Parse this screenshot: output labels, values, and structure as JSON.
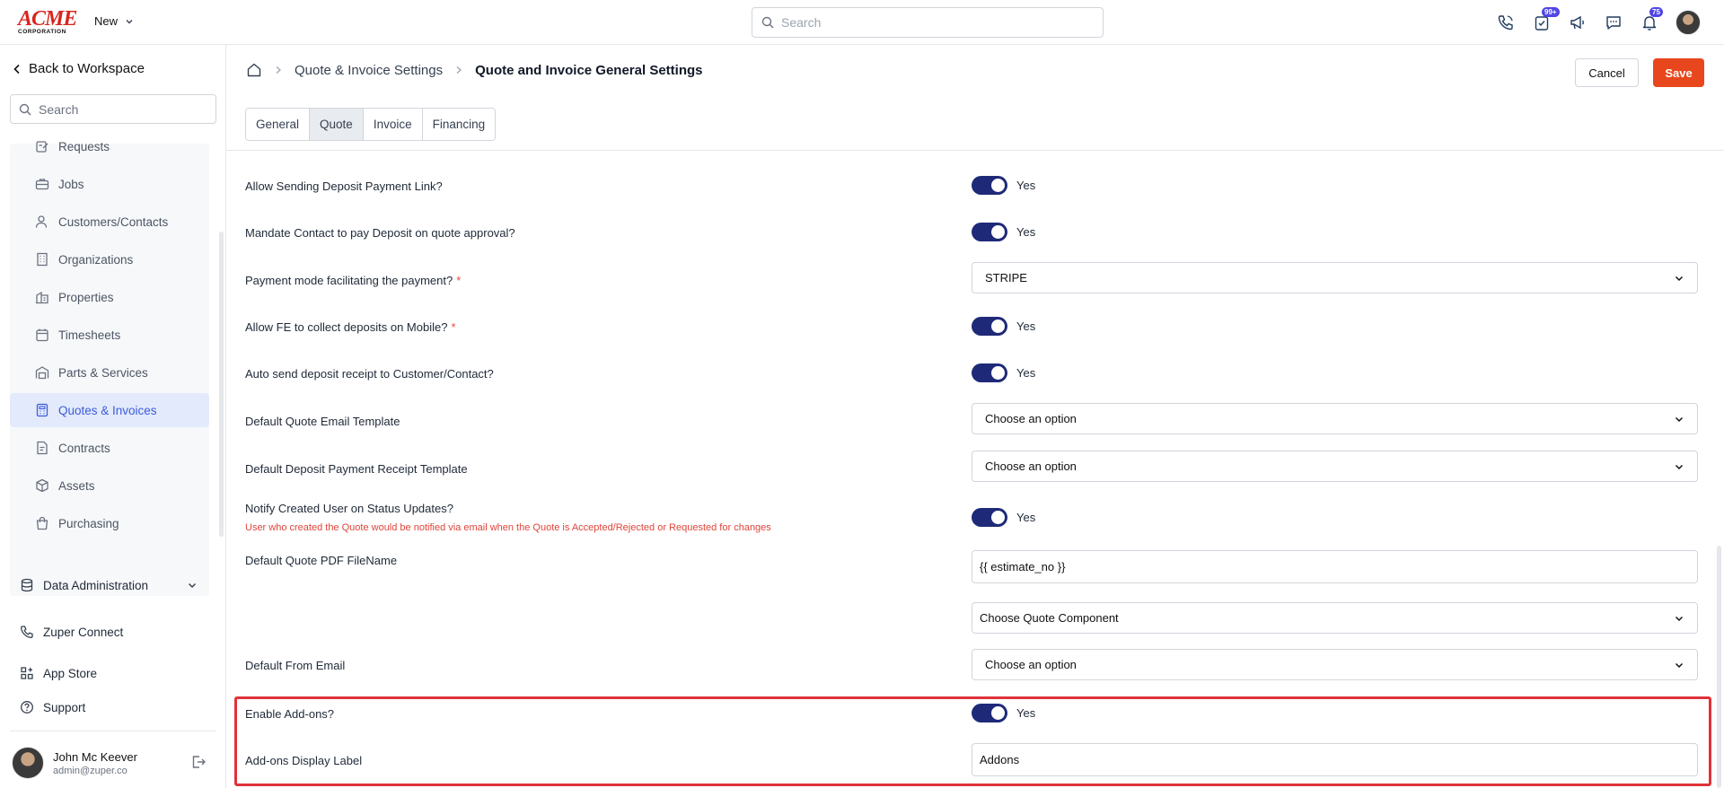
{
  "topbar": {
    "logo_text": "ACME",
    "logo_sub": "CORPORATION",
    "new_label": "New",
    "search_placeholder": "Search",
    "badges": {
      "tasks": "99+",
      "notifications": "75"
    }
  },
  "sidebar": {
    "back_label": "Back to Workspace",
    "search_placeholder": "Search",
    "items": [
      {
        "label": "Requests",
        "icon": "requests-icon"
      },
      {
        "label": "Jobs",
        "icon": "briefcase-icon"
      },
      {
        "label": "Customers/Contacts",
        "icon": "user-icon"
      },
      {
        "label": "Organizations",
        "icon": "building-icon"
      },
      {
        "label": "Properties",
        "icon": "property-icon"
      },
      {
        "label": "Timesheets",
        "icon": "calendar-icon"
      },
      {
        "label": "Parts & Services",
        "icon": "warehouse-icon"
      },
      {
        "label": "Quotes & Invoices",
        "icon": "calculator-icon",
        "active": true
      },
      {
        "label": "Contracts",
        "icon": "contract-icon"
      },
      {
        "label": "Assets",
        "icon": "cube-icon"
      },
      {
        "label": "Purchasing",
        "icon": "shopping-bag-icon"
      }
    ],
    "data_admin_label": "Data Administration",
    "zuper_connect_label": "Zuper Connect",
    "app_store_label": "App Store",
    "support_label": "Support",
    "user": {
      "name": "John Mc Keever",
      "email": "admin@zuper.co"
    }
  },
  "header": {
    "breadcrumb_parent": "Quote & Invoice Settings",
    "breadcrumb_current": "Quote and Invoice General Settings",
    "cancel_label": "Cancel",
    "save_label": "Save",
    "tabs": [
      "General",
      "Quote",
      "Invoice",
      "Financing"
    ],
    "active_tab": "Quote"
  },
  "form": {
    "rows": [
      {
        "label": "Allow Sending Deposit Payment Link?",
        "type": "toggle",
        "value": "Yes"
      },
      {
        "label": "Mandate Contact to pay Deposit on quote approval?",
        "type": "toggle",
        "value": "Yes"
      },
      {
        "label": "Payment mode facilitating the payment?",
        "required": "*",
        "type": "select",
        "value": "STRIPE"
      },
      {
        "label": "Allow FE to collect deposits on Mobile?",
        "required": "*",
        "type": "toggle",
        "value": "Yes"
      },
      {
        "label": "Auto send deposit receipt to Customer/Contact?",
        "type": "toggle",
        "value": "Yes"
      },
      {
        "label": "Default Quote Email Template",
        "type": "select",
        "value": "Choose an option"
      },
      {
        "label": "Default Deposit Payment Receipt Template",
        "type": "select",
        "value": "Choose an option"
      },
      {
        "label": "Notify Created User on Status Updates?",
        "type": "toggle",
        "value": "Yes",
        "hint": "User who created the Quote would be notified via email when the Quote is Accepted/Rejected or Requested for changes"
      },
      {
        "label": "Default Quote PDF FileName",
        "type": "text",
        "value": "{{ estimate_no }}",
        "extra_select": "Choose Quote Component"
      },
      {
        "label": "Default From Email",
        "type": "select",
        "value": "Choose an option"
      },
      {
        "label": "Enable Add-ons?",
        "type": "toggle",
        "value": "Yes"
      },
      {
        "label": "Add-ons Display Label",
        "type": "text",
        "value": "Addons"
      }
    ]
  },
  "colors": {
    "primary_orange": "#e8461c",
    "toggle_on": "#1e2a78",
    "active_nav": "#3b5bdb",
    "highlight_border": "#e0323a",
    "hint_red": "#e0453a"
  }
}
